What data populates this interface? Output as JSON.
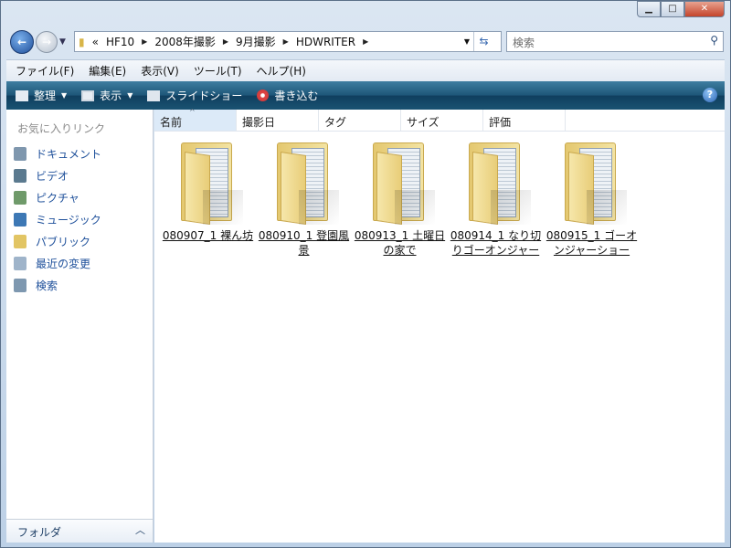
{
  "nav": {
    "breadcrumb": [
      "«",
      "HF10",
      "2008年撮影",
      "9月撮影",
      "HDWRITER"
    ],
    "search_placeholder": "検索"
  },
  "menu": [
    "ファイル(F)",
    "編集(E)",
    "表示(V)",
    "ツール(T)",
    "ヘルプ(H)"
  ],
  "toolbar": {
    "organize": "整理",
    "views": "表示",
    "slideshow": "スライドショー",
    "burn": "書き込む"
  },
  "sidebar": {
    "header": "お気に入りリンク",
    "items": [
      {
        "label": "ドキュメント",
        "icon": "documents-icon"
      },
      {
        "label": "ビデオ",
        "icon": "video-icon"
      },
      {
        "label": "ピクチャ",
        "icon": "pictures-icon"
      },
      {
        "label": "ミュージック",
        "icon": "music-icon"
      },
      {
        "label": "パブリック",
        "icon": "folder-icon"
      },
      {
        "label": "最近の変更",
        "icon": "recent-icon"
      },
      {
        "label": "検索",
        "icon": "search-icon"
      }
    ],
    "folders": "フォルダ"
  },
  "columns": [
    "名前",
    "撮影日",
    "タグ",
    "サイズ",
    "評価"
  ],
  "files": [
    "080907_1 裸ん坊",
    "080910_1 登園風景",
    "080913_1 土曜日の家で",
    "080914_1 なり切りゴーオンジャー",
    "080915_1 ゴーオンジャーショー"
  ]
}
